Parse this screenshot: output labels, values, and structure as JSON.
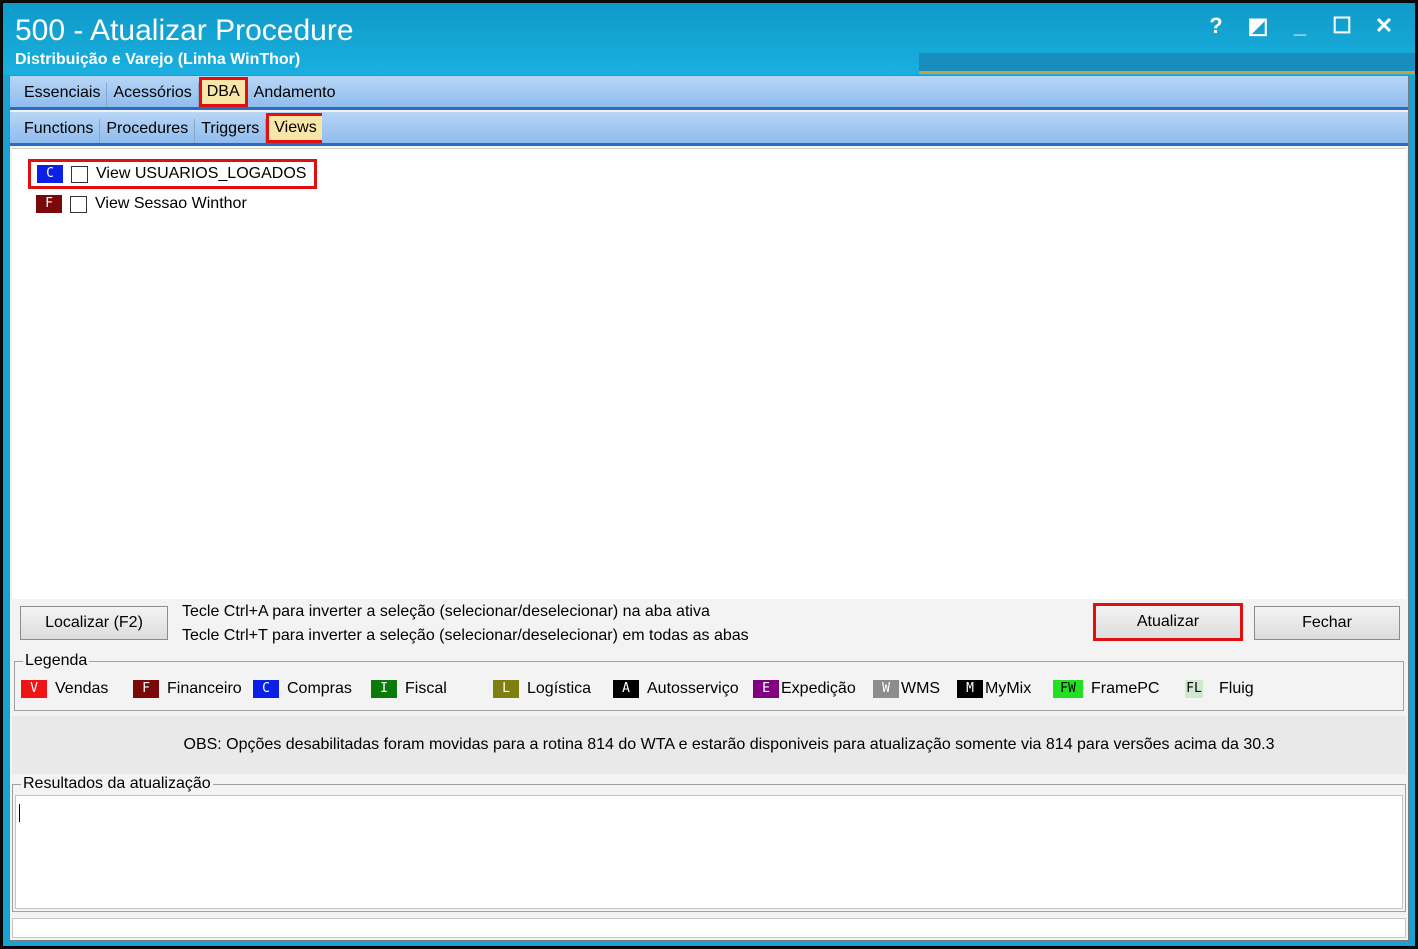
{
  "window": {
    "title": "500 - Atualizar Procedure",
    "subtitle": "Distribuição e Varejo (Linha WinThor)",
    "controls": {
      "help": "?",
      "restore_alt": "◩",
      "minimize": "_",
      "maximize": "☐",
      "close": "✕"
    }
  },
  "main_tabs": [
    {
      "label": "Essenciais"
    },
    {
      "label": "Acessórios"
    },
    {
      "label": "DBA",
      "active": true
    },
    {
      "label": "Andamento"
    }
  ],
  "sub_tabs": [
    {
      "label": "Functions"
    },
    {
      "label": "Procedures"
    },
    {
      "label": "Triggers"
    },
    {
      "label": "Views",
      "active": true
    }
  ],
  "views_list": [
    {
      "badge": "C",
      "badge_color": "#0a1fe8",
      "label": "View USUARIOS_LOGADOS",
      "checked": false
    },
    {
      "badge": "F",
      "badge_color": "#7a0a0a",
      "label": "View Sessao Winthor",
      "checked": false
    }
  ],
  "actions": {
    "locate_label": "Localizar (F2)",
    "hint_line1": "Tecle Ctrl+A para inverter a seleção (selecionar/deselecionar) na aba ativa",
    "hint_line2": "Tecle Ctrl+T para inverter a seleção (selecionar/deselecionar) em todas as abas",
    "update_label": "Atualizar",
    "close_label": "Fechar"
  },
  "legend": {
    "title": "Legenda",
    "items": [
      {
        "badge": "V",
        "color": "#f01414",
        "text_color": "#ffffff",
        "label": "Vendas"
      },
      {
        "badge": "F",
        "color": "#7a0a0a",
        "text_color": "#ffffff",
        "label": "Financeiro"
      },
      {
        "badge": "C",
        "color": "#0a1fe8",
        "text_color": "#ffffff",
        "label": "Compras"
      },
      {
        "badge": "I",
        "color": "#0a7a0a",
        "text_color": "#ffffff",
        "label": "Fiscal"
      },
      {
        "badge": "L",
        "color": "#7f7f10",
        "text_color": "#ffffff",
        "label": "Logística"
      },
      {
        "badge": "A",
        "color": "#000000",
        "text_color": "#ffffff",
        "label": "Autosserviço"
      },
      {
        "badge": "E",
        "color": "#800080",
        "text_color": "#ffffff",
        "label": "Expedição"
      },
      {
        "badge": "W",
        "color": "#8c8c8c",
        "text_color": "#ffffff",
        "label": "WMS"
      },
      {
        "badge": "M",
        "color": "#000000",
        "text_color": "#ffffff",
        "label": "MyMix"
      },
      {
        "badge": "FW",
        "color": "#22e022",
        "text_color": "#000000",
        "label": "FramePC"
      },
      {
        "badge": "FL",
        "color": "#cfe8cf",
        "text_color": "#000000",
        "label": "Fluig"
      }
    ]
  },
  "obs_text": "OBS: Opções desabilitadas foram movidas para a rotina 814 do WTA e estarão disponiveis para atualização somente via 814 para versões acima da 30.3",
  "results": {
    "title": "Resultados da atualização"
  }
}
